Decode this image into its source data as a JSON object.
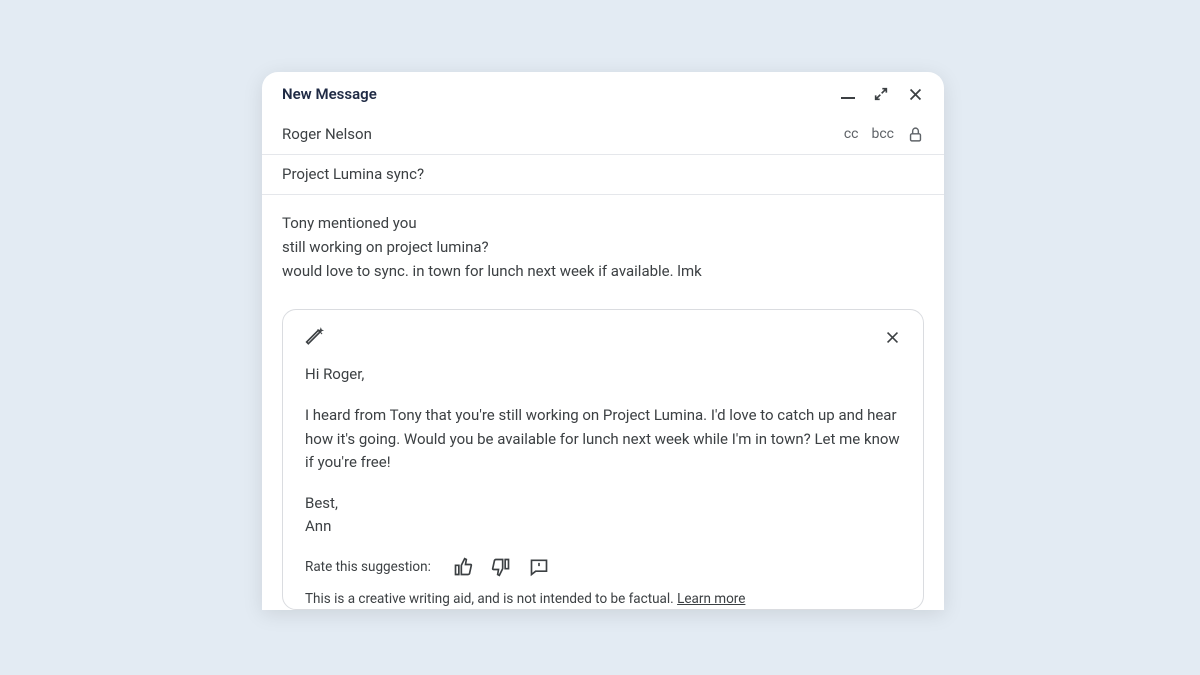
{
  "header": {
    "title": "New Message"
  },
  "to": {
    "name": "Roger Nelson",
    "cc": "cc",
    "bcc": "bcc"
  },
  "subject": "Project Lumina sync?",
  "body": {
    "line1": "Tony mentioned you",
    "line2": "still working on project lumina?",
    "line3": "would love to sync. in town for lunch next week if available. lmk"
  },
  "suggestion": {
    "greeting": "Hi Roger,",
    "para": "I heard from Tony that you're still working on Project Lumina. I'd love to catch up and hear how it's going. Would you be available for lunch next week while I'm in town? Let me know if you're free!",
    "closing": "Best,",
    "signature": "Ann",
    "rate_label": "Rate this suggestion:",
    "disclaimer_text": "This is a creative writing aid, and is not intended to be factual. ",
    "learn_more": "Learn more"
  }
}
